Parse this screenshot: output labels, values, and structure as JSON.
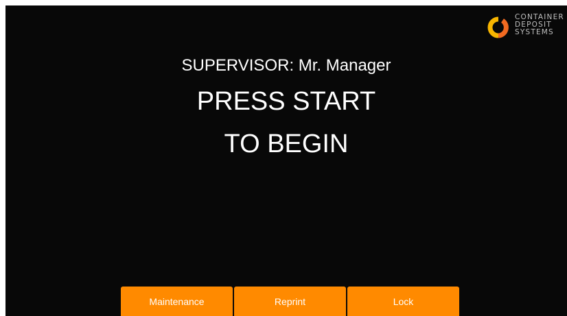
{
  "brand": {
    "logo_icon": "container-deposit-systems-logo",
    "lines": [
      "CONTAINER",
      "DEPOSIT",
      "SYSTEMS"
    ],
    "colors": {
      "accent_yellow": "#f7b500",
      "accent_orange": "#f26a21",
      "text": "#bfbfbf"
    }
  },
  "status": {
    "supervisor": "SUPERVISOR: Mr. Manager"
  },
  "prompt": {
    "line1": "PRESS START",
    "line2": "TO BEGIN"
  },
  "actions": {
    "maintenance_label": "Maintenance",
    "reprint_label": "Reprint",
    "lock_label": "Lock"
  },
  "theme": {
    "background": "#080808",
    "button_color": "#ff8a00",
    "text_color": "#ffffff"
  }
}
